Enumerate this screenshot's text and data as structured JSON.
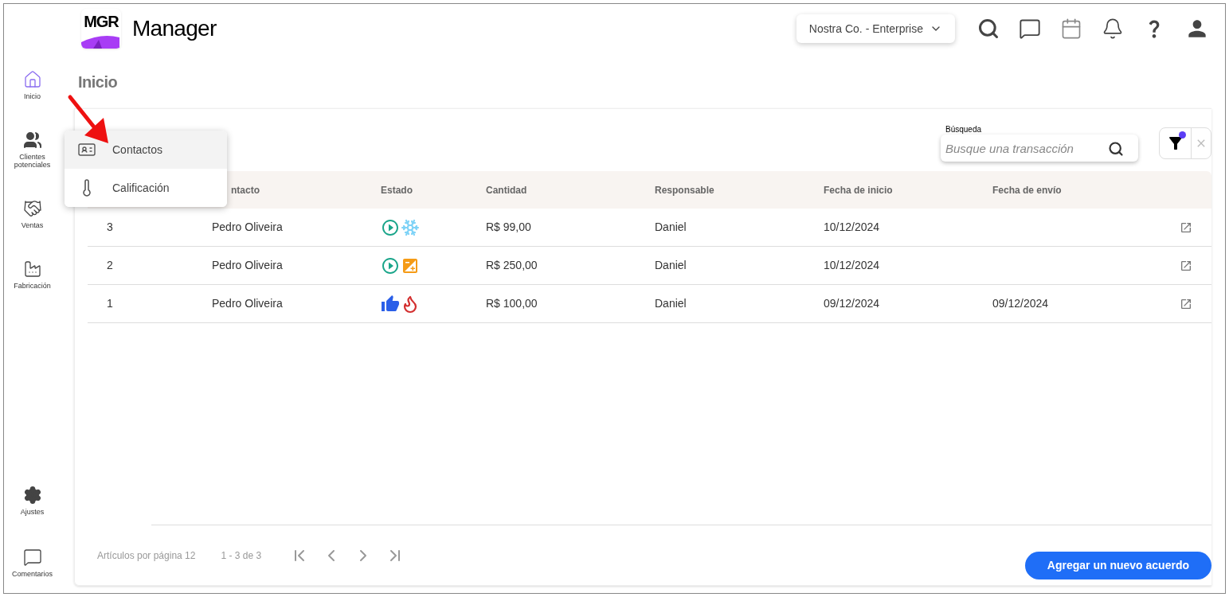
{
  "header": {
    "logo_text": "MGR",
    "app_name": "Manager",
    "company_selector": "Nostra Co. - Enterprise"
  },
  "sidebar": {
    "items": [
      {
        "kind": "home",
        "label": "Inicio",
        "selected": true
      },
      {
        "kind": "people",
        "label": "Clientes potenciales",
        "selected": false
      },
      {
        "kind": "handshake",
        "label": "Ventas",
        "selected": false
      },
      {
        "kind": "factory",
        "label": "Fabricación",
        "selected": false
      }
    ],
    "bottom_items": [
      {
        "kind": "settings",
        "label": "Ajustes",
        "selected": false
      },
      {
        "kind": "comment",
        "label": "Comentarios",
        "selected": false
      }
    ]
  },
  "page_title": "Inicio",
  "menu": {
    "items": [
      {
        "kind": "card",
        "label": "Contactos",
        "selected": true
      },
      {
        "kind": "thermometer",
        "label": "Calificación",
        "selected": false
      }
    ]
  },
  "search": {
    "label": "Búsqueda",
    "placeholder": "Busque una transacción"
  },
  "filter": {
    "active": true
  },
  "table": {
    "columns": [
      "ntacto",
      "Estado",
      "Cantidad",
      "Responsable",
      "Fecha de inicio",
      "Fecha de envío"
    ],
    "rows": [
      {
        "id": "3",
        "contact": "Pedro Oliveira",
        "status": [
          {
            "kind": "play"
          },
          {
            "kind": "cold"
          }
        ],
        "amount": "R$ 99,00",
        "owner": "Daniel",
        "start": "10/12/2024"
      },
      {
        "id": "2",
        "contact": "Pedro Oliveira",
        "status": [
          {
            "kind": "play"
          },
          {
            "kind": "neutral"
          }
        ],
        "amount": "R$ 250,00",
        "owner": "Daniel",
        "start": "10/12/2024"
      },
      {
        "id": "1",
        "contact": "Pedro Oliveira",
        "status": [
          {
            "kind": "like"
          },
          {
            "kind": "hot"
          }
        ],
        "amount": "R$ 100,00",
        "owner": "Daniel",
        "start": "09/12/2024",
        "sent": "09/12/2024"
      }
    ]
  },
  "pagination": {
    "per_page": "Artículos por página 12",
    "range": "1 - 3 de 3"
  },
  "add_button": "Agregar un nuevo acuerdo"
}
